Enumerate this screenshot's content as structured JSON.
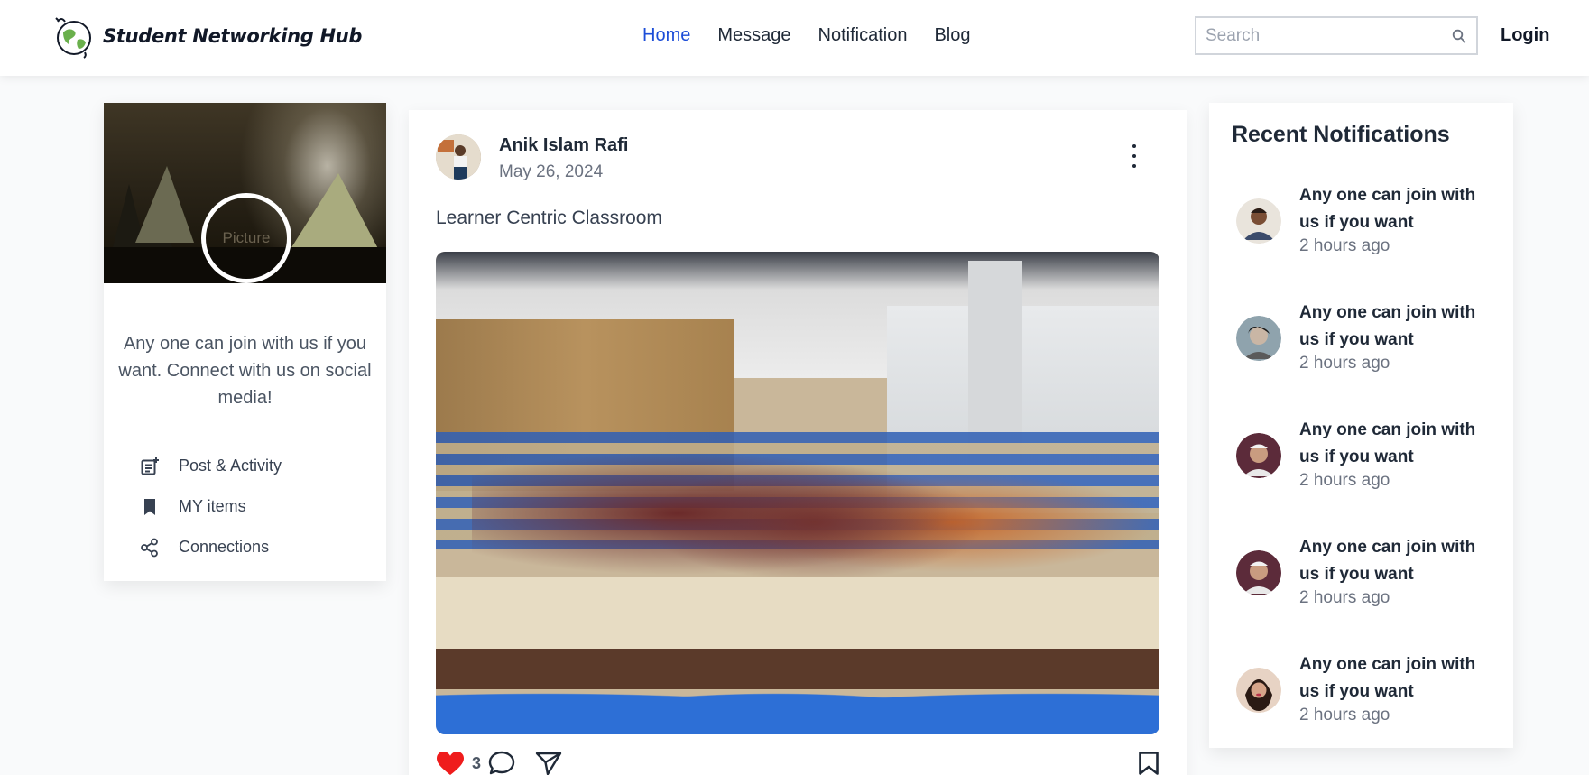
{
  "navbar": {
    "brand": "Student Networking Hub",
    "links": [
      {
        "label": "Home",
        "active": true
      },
      {
        "label": "Message",
        "active": false
      },
      {
        "label": "Notification",
        "active": false
      },
      {
        "label": "Blog",
        "active": false
      }
    ],
    "search_placeholder": "Search",
    "login_label": "Login",
    "accent_color": "#1d4ed8"
  },
  "profile": {
    "avatar_alt": "Picture",
    "about": "Any one can join with us if you want. Connect with us on social media!",
    "menu": [
      {
        "label": "Post & Activity",
        "icon": "post-add-icon"
      },
      {
        "label": "MY items",
        "icon": "bookmark-icon"
      },
      {
        "label": "Connections",
        "icon": "share-icon"
      }
    ]
  },
  "post": {
    "author": "Anik Islam Rafi",
    "date": "May 26, 2024",
    "caption": "Learner Centric Classroom",
    "likes": "3",
    "like_color": "#ef1c1c"
  },
  "notifications": {
    "title": "Recent Notifications",
    "items": [
      {
        "text": "Any one can join with us if you want",
        "time": "2 hours ago"
      },
      {
        "text": "Any one can join with us if you want",
        "time": "2 hours ago"
      },
      {
        "text": "Any one can join with us if you want",
        "time": "2 hours ago"
      },
      {
        "text": "Any one can join with us if you want",
        "time": "2 hours ago"
      },
      {
        "text": "Any one can join with us if you want",
        "time": "2 hours ago"
      }
    ]
  }
}
